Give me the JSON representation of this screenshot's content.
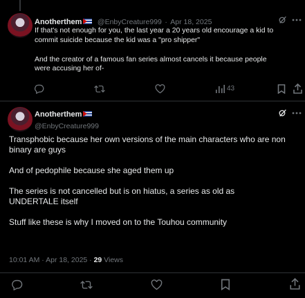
{
  "reply": {
    "display_name": "Anotherthem",
    "handle": "@EnbyCreature999",
    "separator": "·",
    "date": "Apr 18, 2025",
    "lines": [
      "If that's not enough for you, the last year a 20 years old encourage a kid to",
      "commit suicide because the kid was a \"pro shipper\"",
      "",
      "And the creator of a famous fan series almost cancels it because people",
      "were accusing her of-"
    ],
    "views": "43"
  },
  "main": {
    "display_name": "Anotherthem",
    "handle": "@EnbyCreature999",
    "paragraphs": [
      "Transphobic because her own versions of the main characters who are non binary are guys",
      "And of pedophile because she aged them up",
      "The series is not cancelled but is on hiatus, a series as old as UNDERTALE itself",
      "Stuff like these is why I moved on to the Touhou community"
    ],
    "timestamp": "10:01 AM · Apr 18, 2025 · ",
    "views_count": "29",
    "views_label": " Views"
  },
  "icons": {
    "reply": "reply-icon",
    "repost": "repost-icon",
    "like": "heart-icon",
    "views": "views-icon",
    "bookmark": "bookmark-icon",
    "share": "share-icon",
    "grok": "grok-icon",
    "more": "more-icon",
    "flag": "cuba-flag-icon"
  },
  "colors": {
    "background": "#000000",
    "text": "#e7e9ea",
    "muted": "#71767b",
    "divider": "#2f3336"
  }
}
